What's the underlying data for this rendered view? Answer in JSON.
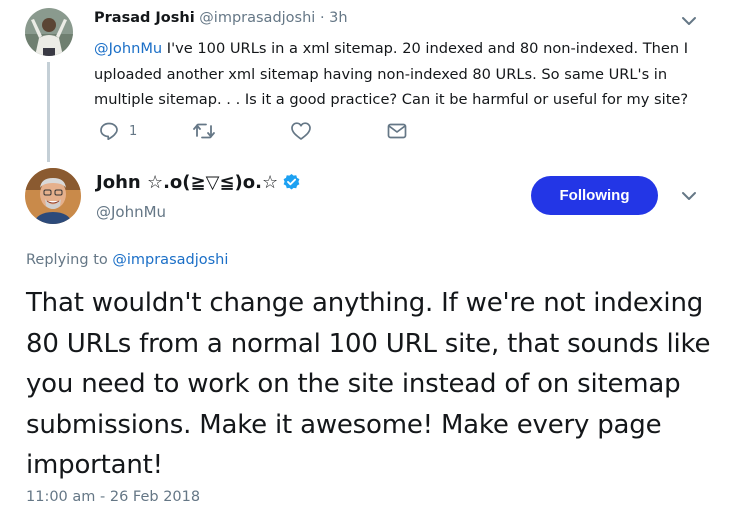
{
  "parent_tweet": {
    "author_name": "Prasad Joshi",
    "author_handle": "@imprasadjoshi",
    "separator": "·",
    "time_ago": "3h",
    "mention": "@JohnMu",
    "text": " I've 100 URLs in a xml sitemap. 20 indexed and 80 non-indexed. Then I uploaded another xml sitemap having non-indexed 80 URLs. So same URL's in multiple sitemap. . . Is it a good practice? Can it be harmful or useful for my site?",
    "actions": {
      "reply_count": "1",
      "reply_icon": "reply-icon",
      "retweet_icon": "retweet-icon",
      "like_icon": "heart-icon",
      "message_icon": "envelope-icon"
    }
  },
  "main_tweet": {
    "author_name": "John ☆.o(≧▽≦)o.☆",
    "author_handle": "@JohnMu",
    "verified_icon": "verified-badge-icon",
    "follow_button_label": "Following",
    "replying_prefix": "Replying to ",
    "replying_handle": "@imprasadjoshi",
    "text": "That wouldn't change anything. If we're not indexing 80 URLs from a normal 100 URL site, that sounds like you need to work on the site instead of on sitemap submissions. Make it awesome! Make every page important!",
    "timestamp": "11:00 am - 26 Feb 2018"
  },
  "colors": {
    "link": "#1b6fc7",
    "muted": "#657786",
    "follow_button": "#2336e6",
    "verified": "#1da1f2",
    "thread_line": "#c4cfd6"
  }
}
